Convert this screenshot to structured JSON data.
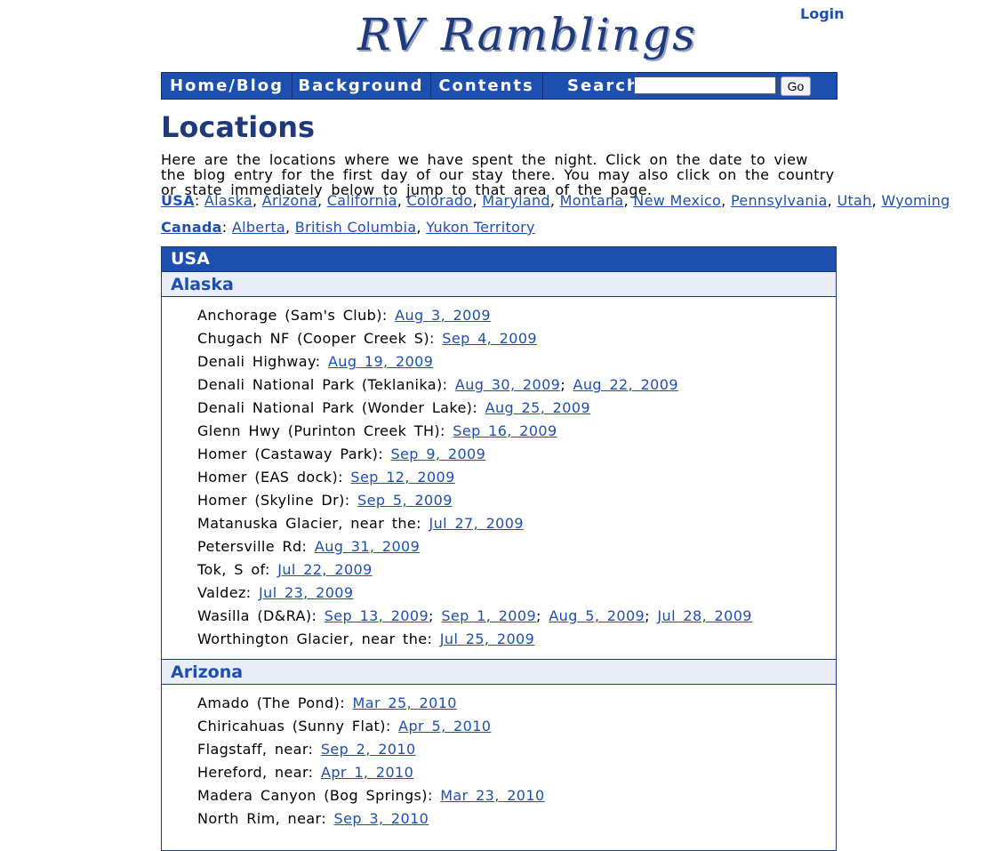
{
  "header": {
    "logo_text": "RV Ramblings",
    "login": "Login"
  },
  "nav": {
    "tabs": [
      "Home/Blog",
      "Background",
      "Contents"
    ],
    "search_label": "Search:",
    "search_value": "",
    "go": "Go"
  },
  "page_title": "Locations",
  "intro": "Here are the locations where we have spent the night. Click on the date to view the blog entry for the first day of our stay there. You may also click on the country or state immediately below to jump to that area of the page.",
  "regions": [
    {
      "country": "USA",
      "items": [
        "Alaska",
        "Arizona",
        "California",
        "Colorado",
        "Maryland",
        "Montana",
        "New Mexico",
        "Pennsylvania",
        "Utah",
        "Wyoming"
      ]
    },
    {
      "country": "Canada",
      "items": [
        "Alberta",
        "British Columbia",
        "Yukon Territory"
      ]
    }
  ],
  "section": {
    "country": "USA",
    "states": [
      {
        "name": "Alaska",
        "locations": [
          {
            "place": "Anchorage (Sam's Club):",
            "dates": [
              "Aug 3, 2009"
            ]
          },
          {
            "place": "Chugach NF (Cooper Creek S):",
            "dates": [
              "Sep 4, 2009"
            ]
          },
          {
            "place": "Denali Highway:",
            "dates": [
              "Aug 19, 2009"
            ]
          },
          {
            "place": "Denali National Park (Teklanika):",
            "dates": [
              "Aug 30, 2009",
              "Aug 22, 2009"
            ]
          },
          {
            "place": "Denali National Park (Wonder Lake):",
            "dates": [
              "Aug 25, 2009"
            ]
          },
          {
            "place": "Glenn Hwy (Purinton Creek TH):",
            "dates": [
              "Sep 16, 2009"
            ]
          },
          {
            "place": "Homer (Castaway Park):",
            "dates": [
              "Sep 9, 2009"
            ]
          },
          {
            "place": "Homer (EAS dock):",
            "dates": [
              "Sep 12, 2009"
            ]
          },
          {
            "place": "Homer (Skyline Dr):",
            "dates": [
              "Sep 5, 2009"
            ]
          },
          {
            "place": "Matanuska Glacier, near the:",
            "dates": [
              "Jul 27, 2009"
            ]
          },
          {
            "place": "Petersville Rd:",
            "dates": [
              "Aug 31, 2009"
            ]
          },
          {
            "place": "Tok, S of:",
            "dates": [
              "Jul 22, 2009"
            ]
          },
          {
            "place": "Valdez:",
            "dates": [
              "Jul 23, 2009"
            ]
          },
          {
            "place": "Wasilla (D&RA):",
            "dates": [
              "Sep 13, 2009",
              "Sep 1, 2009",
              "Aug 5, 2009",
              "Jul 28, 2009"
            ]
          },
          {
            "place": "Worthington Glacier, near the:",
            "dates": [
              "Jul 25, 2009"
            ]
          }
        ]
      },
      {
        "name": "Arizona",
        "locations": [
          {
            "place": "Amado (The Pond):",
            "dates": [
              "Mar 25, 2010"
            ]
          },
          {
            "place": "Chiricahuas (Sunny Flat):",
            "dates": [
              "Apr 5, 2010"
            ]
          },
          {
            "place": "Flagstaff, near:",
            "dates": [
              "Sep 2, 2010"
            ]
          },
          {
            "place": "Hereford, near:",
            "dates": [
              "Apr 1, 2010"
            ]
          },
          {
            "place": "Madera Canyon (Bog Springs):",
            "dates": [
              "Mar 23, 2010"
            ]
          },
          {
            "place": "North Rim, near:",
            "dates": [
              "Sep 3, 2010"
            ]
          }
        ]
      }
    ]
  }
}
